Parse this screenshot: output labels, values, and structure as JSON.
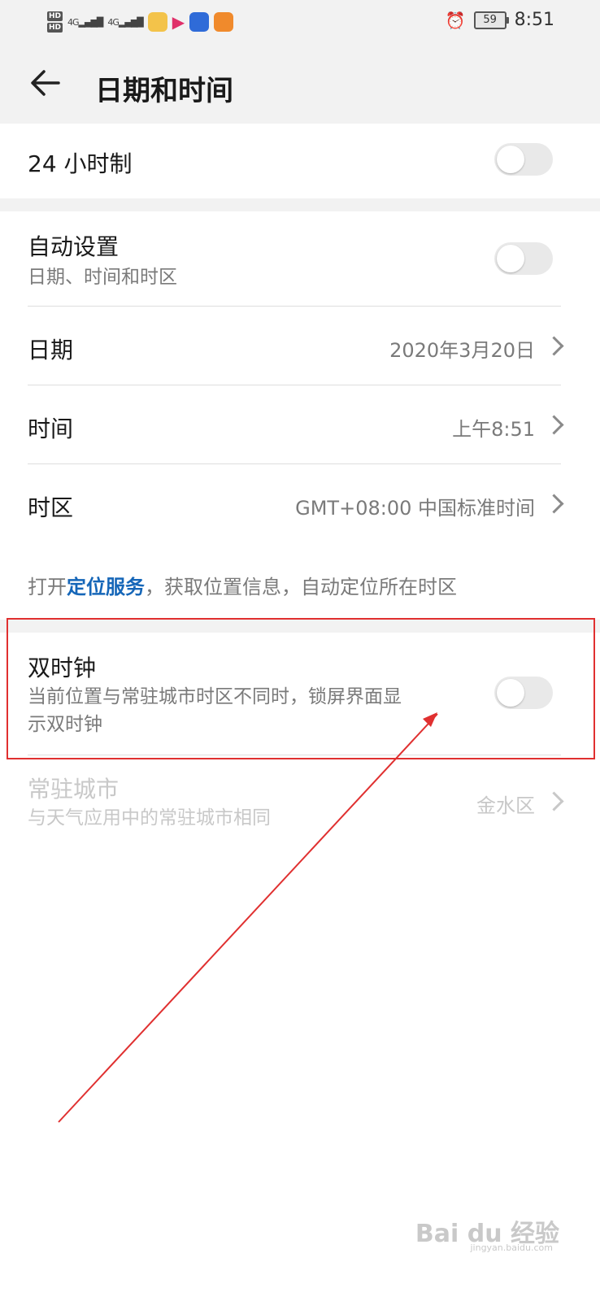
{
  "status_bar": {
    "hd1": "HD",
    "hd2": "HD",
    "signal1": "4G",
    "signal2": "4G",
    "battery": "59",
    "time": "8:51",
    "alarm_icon": "alarm-icon",
    "app_icons": [
      "tiger-app-icon",
      "video-app-icon",
      "baidu-app-icon",
      "uc-browser-icon"
    ]
  },
  "header": {
    "back_icon": "back-arrow-icon",
    "title": "日期和时间"
  },
  "settings": {
    "hour24": {
      "label": "24 小时制",
      "enabled": false
    },
    "auto": {
      "label": "自动设置",
      "sub": "日期、时间和时区",
      "enabled": false
    },
    "date": {
      "label": "日期",
      "value": "2020年3月20日"
    },
    "time": {
      "label": "时间",
      "value": "上午8:51"
    },
    "timezone": {
      "label": "时区",
      "value": "GMT+08:00 中国标准时间"
    },
    "location_note": {
      "prefix": "打开",
      "link": "定位服务",
      "suffix": "，获取位置信息，自动定位所在时区"
    },
    "dual_clock": {
      "label": "双时钟",
      "sub_line1": "当前位置与常驻城市时区不同时，锁屏界面显",
      "sub_line2": "示双时钟",
      "enabled": false
    },
    "home_city": {
      "label": "常驻城市",
      "sub": "与天气应用中的常驻城市相同",
      "value": "金水区"
    }
  },
  "watermark": {
    "text": "Bai du 经验",
    "sub": "jingyan.baidu.com"
  },
  "colors": {
    "accent_link": "#1566b8",
    "annotation_red": "#e03030",
    "header_bg": "#f2f2f2"
  }
}
